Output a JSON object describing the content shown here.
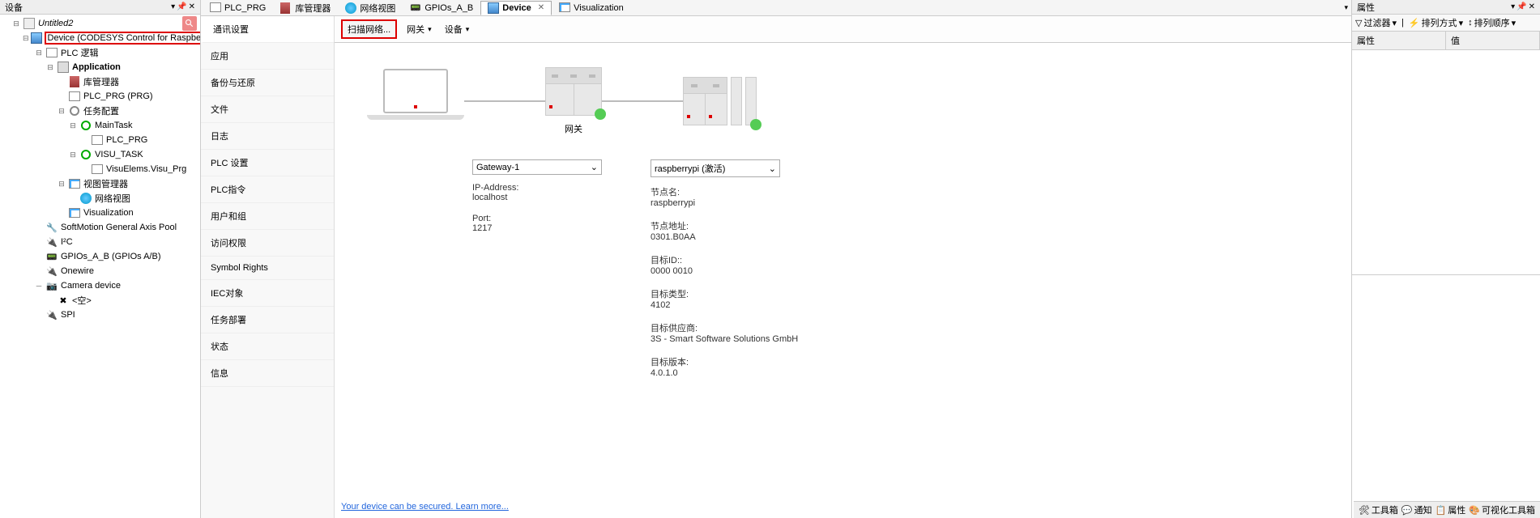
{
  "left_panel": {
    "title": "设备",
    "pin": "📌",
    "close": "✕",
    "project": "Untitled2",
    "device": "Device (CODESYS Control for Raspberry Pi SL)",
    "plc_logic": "PLC 逻辑",
    "application": "Application",
    "lib_manager": "库管理器",
    "plc_prg": "PLC_PRG (PRG)",
    "task_config": "任务配置",
    "main_task": "MainTask",
    "plc_prg_task": "PLC_PRG",
    "visu_task": "VISU_TASK",
    "visu_elems": "VisuElems.Visu_Prg",
    "visu_manager": "视图管理器",
    "net_view": "网络视图",
    "visualization": "Visualization",
    "softmotion": "SoftMotion General Axis Pool",
    "i2c": "I²C",
    "gpios": "GPIOs_A_B (GPIOs A/B)",
    "onewire": "Onewire",
    "camera": "Camera device",
    "empty": "<空>",
    "spi": "SPI"
  },
  "tabs": [
    {
      "label": "PLC_PRG",
      "active": false
    },
    {
      "label": "库管理器",
      "active": false
    },
    {
      "label": "网络视图",
      "active": false
    },
    {
      "label": "GPIOs_A_B",
      "active": false
    },
    {
      "label": "Device",
      "active": true
    },
    {
      "label": "Visualization",
      "active": false
    }
  ],
  "sidebar": [
    "通讯设置",
    "应用",
    "备份与还原",
    "文件",
    "日志",
    "PLC 设置",
    "PLC指令",
    "用户和组",
    "访问权限",
    "Symbol Rights",
    "IEC对象",
    "任务部署",
    "状态",
    "信息"
  ],
  "toolbar": {
    "scan": "扫描网络...",
    "gateway": "网关",
    "device": "设备"
  },
  "diagram": {
    "gateway_label": "网关"
  },
  "gateway": {
    "combo": "Gateway-1",
    "ip_label": "IP-Address:",
    "ip_value": "localhost",
    "port_label": "Port:",
    "port_value": "1217"
  },
  "device_info": {
    "combo": "raspberrypi (激活)",
    "node_name_label": "节点名:",
    "node_name": "raspberrypi",
    "node_addr_label": "节点地址:",
    "node_addr": "0301.B0AA",
    "target_id_label": "目标ID::",
    "target_id": "0000 0010",
    "target_type_label": "目标类型:",
    "target_type": "4102",
    "vendor_label": "目标供应商:",
    "vendor": "3S - Smart Software Solutions GmbH",
    "version_label": "目标版本:",
    "version": "4.0.1.0"
  },
  "secure_link": "Your device can be secured. Learn more...",
  "properties": {
    "title": "属性",
    "filter": "过滤器",
    "sort": "排列方式",
    "order": "排列顺序",
    "col_prop": "属性",
    "col_val": "值"
  },
  "status": {
    "toolbox": "工具箱",
    "notify": "通知",
    "props": "属性",
    "visu": "可视化工具箱"
  }
}
